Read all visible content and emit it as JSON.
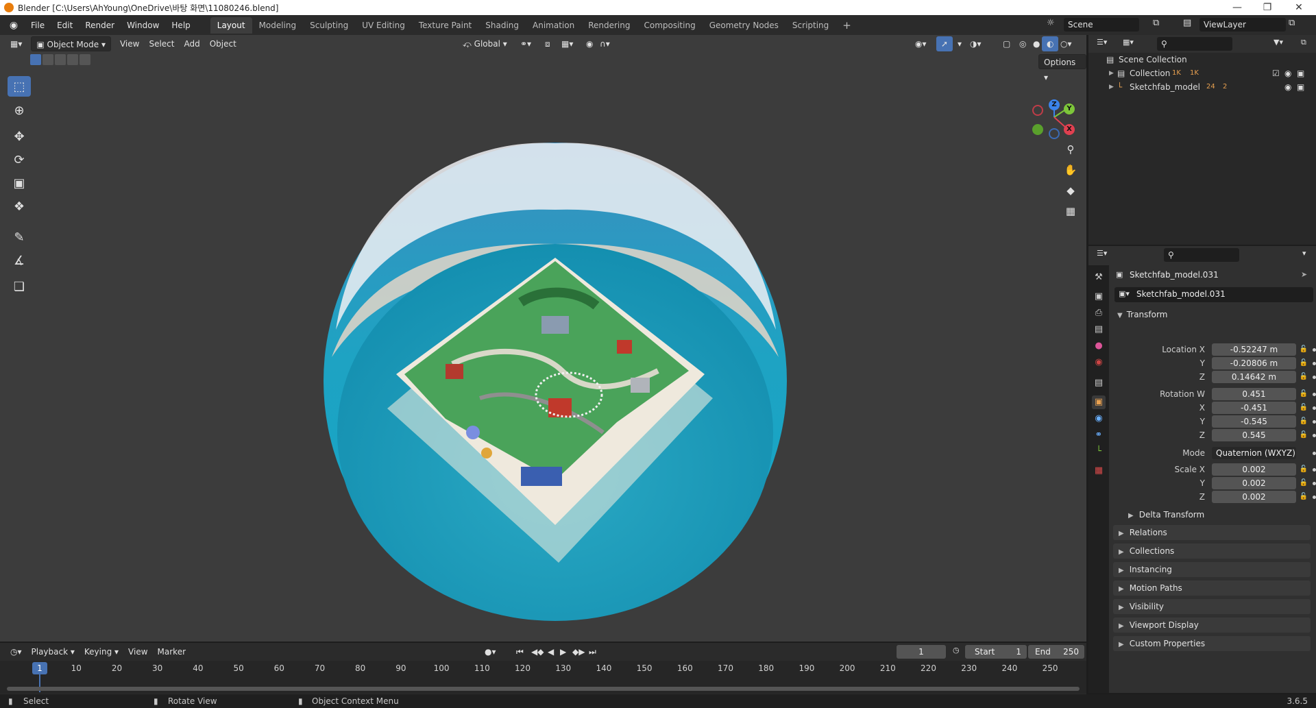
{
  "window": {
    "title": "Blender [C:\\Users\\AhYoung\\OneDrive\\바탕 화면\\11080246.blend]"
  },
  "menu": [
    "File",
    "Edit",
    "Render",
    "Window",
    "Help"
  ],
  "workspaces": [
    "Layout",
    "Modeling",
    "Sculpting",
    "UV Editing",
    "Texture Paint",
    "Shading",
    "Animation",
    "Rendering",
    "Compositing",
    "Geometry Nodes",
    "Scripting"
  ],
  "active_workspace": "Layout",
  "scene": {
    "name": "Scene",
    "view_layer": "ViewLayer"
  },
  "viewport": {
    "mode": "Object Mode",
    "menus": [
      "View",
      "Select",
      "Add",
      "Object"
    ],
    "transform_orientation": "Global",
    "options_label": "Options",
    "axes": {
      "x": "X",
      "y": "Y",
      "z": "Z"
    }
  },
  "outliner": {
    "root": "Scene Collection",
    "items": [
      {
        "name": "Collection",
        "badge1": "1K",
        "badge2": "1K"
      },
      {
        "name": "Sketchfab_model",
        "badge1": "24",
        "badge2": "2"
      }
    ]
  },
  "properties": {
    "object_name": "Sketchfab_model.031",
    "data_name": "Sketchfab_model.031",
    "transform_title": "Transform",
    "location": {
      "label": "Location X",
      "x": "-0.52247 m",
      "y": "-0.20806 m",
      "z": "0.14642 m"
    },
    "rotation": {
      "label": "Rotation W",
      "w": "0.451",
      "x": "-0.451",
      "y": "-0.545",
      "z": "0.545"
    },
    "mode": {
      "label": "Mode",
      "value": "Quaternion (WXYZ)"
    },
    "scale": {
      "label": "Scale X",
      "x": "0.002",
      "y": "0.002",
      "z": "0.002"
    },
    "axis_labels": {
      "x": "X",
      "y": "Y",
      "z": "Z"
    },
    "delta_transform": "Delta Transform",
    "panels": [
      "Relations",
      "Collections",
      "Instancing",
      "Motion Paths",
      "Visibility",
      "Viewport Display",
      "Custom Properties"
    ]
  },
  "timeline": {
    "menus": [
      "Playback",
      "Keying",
      "View",
      "Marker"
    ],
    "current_frame": "1",
    "start_label": "Start",
    "start": "1",
    "end_label": "End",
    "end": "250",
    "ticks": [
      "10",
      "20",
      "30",
      "40",
      "50",
      "60",
      "70",
      "80",
      "90",
      "100",
      "110",
      "120",
      "130",
      "140",
      "150",
      "160",
      "170",
      "180",
      "190",
      "200",
      "210",
      "220",
      "230",
      "240",
      "250"
    ]
  },
  "statusbar": {
    "select": "Select",
    "rotate": "Rotate View",
    "context_menu": "Object Context Menu",
    "version": "3.6.5"
  },
  "colors": {
    "accent": "#4772b3",
    "ocean": "#1ea3c3",
    "grass": "#4aa35a",
    "sand": "#e6ddd0"
  }
}
